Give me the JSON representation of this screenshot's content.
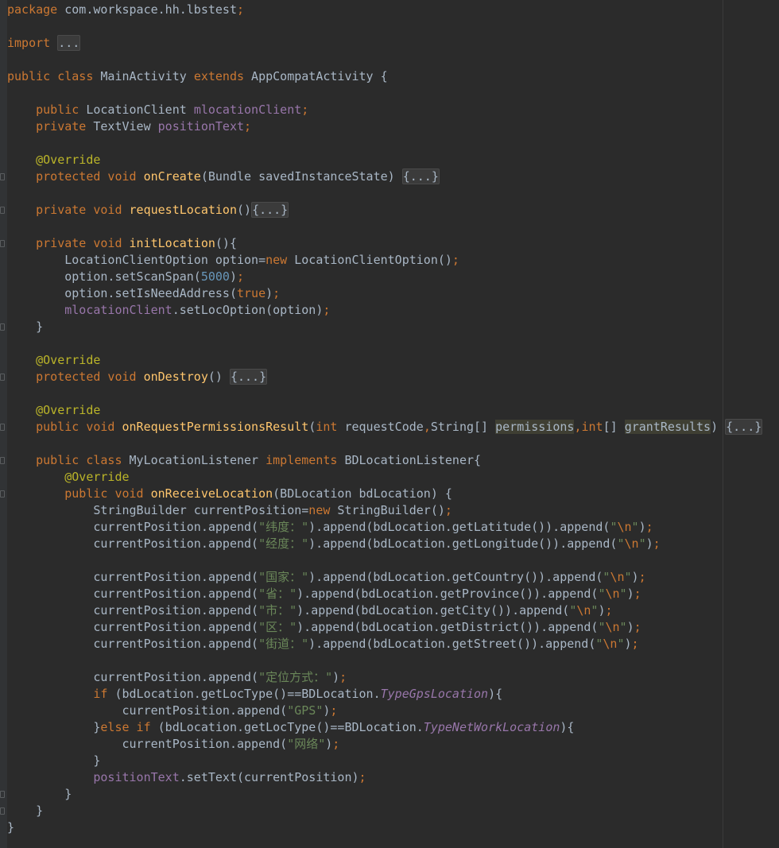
{
  "editor": {
    "language": "Java",
    "theme_colors": {
      "background": "#2b2b2b",
      "keyword": "#cc7832",
      "annotation": "#bbb529",
      "function": "#ffc66d",
      "field": "#9876aa",
      "number": "#6897bb",
      "string": "#6a8759",
      "plain": "#a9b7c6"
    },
    "lines": [
      {
        "fold": false,
        "tokens": [
          {
            "t": "package",
            "c": "kw"
          },
          {
            "t": " com.workspace.hh.lbstest",
            "c": "plain"
          },
          {
            "t": ";",
            "c": "kw"
          }
        ]
      },
      {
        "fold": false,
        "tokens": []
      },
      {
        "fold": false,
        "tokens": [
          {
            "t": "import",
            "c": "kw"
          },
          {
            "t": " ",
            "c": "plain"
          },
          {
            "t": "...",
            "c": "folded"
          }
        ]
      },
      {
        "fold": false,
        "tokens": []
      },
      {
        "fold": false,
        "tokens": [
          {
            "t": "public class",
            "c": "kw"
          },
          {
            "t": " MainActivity ",
            "c": "plain"
          },
          {
            "t": "extends",
            "c": "kw"
          },
          {
            "t": " AppCompatActivity {",
            "c": "plain"
          }
        ]
      },
      {
        "fold": false,
        "tokens": []
      },
      {
        "fold": false,
        "tokens": [
          {
            "t": "    ",
            "c": "plain"
          },
          {
            "t": "public",
            "c": "kw"
          },
          {
            "t": " LocationClient ",
            "c": "plain"
          },
          {
            "t": "mlocationClient",
            "c": "field"
          },
          {
            "t": ";",
            "c": "kw"
          }
        ]
      },
      {
        "fold": false,
        "tokens": [
          {
            "t": "    ",
            "c": "plain"
          },
          {
            "t": "private",
            "c": "kw"
          },
          {
            "t": " TextView ",
            "c": "plain"
          },
          {
            "t": "positionText",
            "c": "field"
          },
          {
            "t": ";",
            "c": "kw"
          }
        ]
      },
      {
        "fold": false,
        "tokens": []
      },
      {
        "fold": false,
        "tokens": [
          {
            "t": "    ",
            "c": "plain"
          },
          {
            "t": "@Override",
            "c": "ann"
          }
        ]
      },
      {
        "fold": true,
        "tokens": [
          {
            "t": "    ",
            "c": "plain"
          },
          {
            "t": "protected void",
            "c": "kw"
          },
          {
            "t": " ",
            "c": "plain"
          },
          {
            "t": "onCreate",
            "c": "fn"
          },
          {
            "t": "(Bundle savedInstanceState) ",
            "c": "plain"
          },
          {
            "t": "{...}",
            "c": "folded"
          }
        ]
      },
      {
        "fold": false,
        "tokens": []
      },
      {
        "fold": true,
        "tokens": [
          {
            "t": "    ",
            "c": "plain"
          },
          {
            "t": "private void",
            "c": "kw"
          },
          {
            "t": " ",
            "c": "plain"
          },
          {
            "t": "requestLocation",
            "c": "fn"
          },
          {
            "t": "()",
            "c": "plain"
          },
          {
            "t": "{...}",
            "c": "folded"
          }
        ]
      },
      {
        "fold": false,
        "tokens": []
      },
      {
        "fold": true,
        "tokens": [
          {
            "t": "    ",
            "c": "plain"
          },
          {
            "t": "private void",
            "c": "kw"
          },
          {
            "t": " ",
            "c": "plain"
          },
          {
            "t": "initLocation",
            "c": "fn"
          },
          {
            "t": "(){",
            "c": "plain"
          }
        ]
      },
      {
        "fold": false,
        "tokens": [
          {
            "t": "        LocationClientOption option=",
            "c": "plain"
          },
          {
            "t": "new",
            "c": "kw"
          },
          {
            "t": " LocationClientOption()",
            "c": "plain"
          },
          {
            "t": ";",
            "c": "kw"
          }
        ]
      },
      {
        "fold": false,
        "tokens": [
          {
            "t": "        option.setScanSpan(",
            "c": "plain"
          },
          {
            "t": "5000",
            "c": "num"
          },
          {
            "t": ")",
            "c": "plain"
          },
          {
            "t": ";",
            "c": "kw"
          }
        ]
      },
      {
        "fold": false,
        "tokens": [
          {
            "t": "        option.setIsNeedAddress(",
            "c": "plain"
          },
          {
            "t": "true",
            "c": "kw"
          },
          {
            "t": ")",
            "c": "plain"
          },
          {
            "t": ";",
            "c": "kw"
          }
        ]
      },
      {
        "fold": false,
        "tokens": [
          {
            "t": "        ",
            "c": "plain"
          },
          {
            "t": "mlocationClient",
            "c": "field"
          },
          {
            "t": ".setLocOption(option)",
            "c": "plain"
          },
          {
            "t": ";",
            "c": "kw"
          }
        ]
      },
      {
        "fold": true,
        "tokens": [
          {
            "t": "    }",
            "c": "plain"
          }
        ]
      },
      {
        "fold": false,
        "tokens": []
      },
      {
        "fold": false,
        "tokens": [
          {
            "t": "    ",
            "c": "plain"
          },
          {
            "t": "@Override",
            "c": "ann"
          }
        ]
      },
      {
        "fold": true,
        "tokens": [
          {
            "t": "    ",
            "c": "plain"
          },
          {
            "t": "protected void",
            "c": "kw"
          },
          {
            "t": " ",
            "c": "plain"
          },
          {
            "t": "onDestroy",
            "c": "fn"
          },
          {
            "t": "() ",
            "c": "plain"
          },
          {
            "t": "{...}",
            "c": "folded"
          }
        ]
      },
      {
        "fold": false,
        "tokens": []
      },
      {
        "fold": false,
        "tokens": [
          {
            "t": "    ",
            "c": "plain"
          },
          {
            "t": "@Override",
            "c": "ann"
          }
        ]
      },
      {
        "fold": true,
        "tokens": [
          {
            "t": "    ",
            "c": "plain"
          },
          {
            "t": "public void",
            "c": "kw"
          },
          {
            "t": " ",
            "c": "plain"
          },
          {
            "t": "onRequestPermissionsResult",
            "c": "fn"
          },
          {
            "t": "(",
            "c": "plain"
          },
          {
            "t": "int",
            "c": "kw"
          },
          {
            "t": " requestCode",
            "c": "plain"
          },
          {
            "t": ",",
            "c": "kw"
          },
          {
            "t": "String[] ",
            "c": "plain"
          },
          {
            "t": "permissions",
            "c": "unused"
          },
          {
            "t": ",",
            "c": "kw"
          },
          {
            "t": "int",
            "c": "kw"
          },
          {
            "t": "[] ",
            "c": "plain"
          },
          {
            "t": "grantResults",
            "c": "unused"
          },
          {
            "t": ") ",
            "c": "plain"
          },
          {
            "t": "{...}",
            "c": "folded"
          }
        ]
      },
      {
        "fold": false,
        "tokens": []
      },
      {
        "fold": true,
        "tokens": [
          {
            "t": "    ",
            "c": "plain"
          },
          {
            "t": "public class",
            "c": "kw"
          },
          {
            "t": " MyLocationListener ",
            "c": "plain"
          },
          {
            "t": "implements",
            "c": "kw"
          },
          {
            "t": " BDLocationListener{",
            "c": "plain"
          }
        ]
      },
      {
        "fold": false,
        "tokens": [
          {
            "t": "        ",
            "c": "plain"
          },
          {
            "t": "@Override",
            "c": "ann"
          }
        ]
      },
      {
        "fold": true,
        "tokens": [
          {
            "t": "        ",
            "c": "plain"
          },
          {
            "t": "public void",
            "c": "kw"
          },
          {
            "t": " ",
            "c": "plain"
          },
          {
            "t": "onReceiveLocation",
            "c": "fn"
          },
          {
            "t": "(BDLocation bdLocation) {",
            "c": "plain"
          }
        ]
      },
      {
        "fold": false,
        "tokens": [
          {
            "t": "            StringBuilder currentPosition=",
            "c": "plain"
          },
          {
            "t": "new",
            "c": "kw"
          },
          {
            "t": " StringBuilder()",
            "c": "plain"
          },
          {
            "t": ";",
            "c": "kw"
          }
        ]
      },
      {
        "fold": false,
        "tokens": [
          {
            "t": "            currentPosition.append(",
            "c": "plain"
          },
          {
            "t": "\"纬度：\"",
            "c": "str"
          },
          {
            "t": ").append(bdLocation.getLatitude()).append(",
            "c": "plain"
          },
          {
            "t": "\"",
            "c": "str"
          },
          {
            "t": "\\n",
            "c": "esc"
          },
          {
            "t": "\"",
            "c": "str"
          },
          {
            "t": ")",
            "c": "plain"
          },
          {
            "t": ";",
            "c": "kw"
          }
        ]
      },
      {
        "fold": false,
        "tokens": [
          {
            "t": "            currentPosition.append(",
            "c": "plain"
          },
          {
            "t": "\"经度：\"",
            "c": "str"
          },
          {
            "t": ").append(bdLocation.getLongitude()).append(",
            "c": "plain"
          },
          {
            "t": "\"",
            "c": "str"
          },
          {
            "t": "\\n",
            "c": "esc"
          },
          {
            "t": "\"",
            "c": "str"
          },
          {
            "t": ")",
            "c": "plain"
          },
          {
            "t": ";",
            "c": "kw"
          }
        ]
      },
      {
        "fold": false,
        "tokens": []
      },
      {
        "fold": false,
        "tokens": [
          {
            "t": "            currentPosition.append(",
            "c": "plain"
          },
          {
            "t": "\"国家：\"",
            "c": "str"
          },
          {
            "t": ").append(bdLocation.getCountry()).append(",
            "c": "plain"
          },
          {
            "t": "\"",
            "c": "str"
          },
          {
            "t": "\\n",
            "c": "esc"
          },
          {
            "t": "\"",
            "c": "str"
          },
          {
            "t": ")",
            "c": "plain"
          },
          {
            "t": ";",
            "c": "kw"
          }
        ]
      },
      {
        "fold": false,
        "tokens": [
          {
            "t": "            currentPosition.append(",
            "c": "plain"
          },
          {
            "t": "\"省：\"",
            "c": "str"
          },
          {
            "t": ").append(bdLocation.getProvince()).append(",
            "c": "plain"
          },
          {
            "t": "\"",
            "c": "str"
          },
          {
            "t": "\\n",
            "c": "esc"
          },
          {
            "t": "\"",
            "c": "str"
          },
          {
            "t": ")",
            "c": "plain"
          },
          {
            "t": ";",
            "c": "kw"
          }
        ]
      },
      {
        "fold": false,
        "tokens": [
          {
            "t": "            currentPosition.append(",
            "c": "plain"
          },
          {
            "t": "\"市：\"",
            "c": "str"
          },
          {
            "t": ").append(bdLocation.getCity()).append(",
            "c": "plain"
          },
          {
            "t": "\"",
            "c": "str"
          },
          {
            "t": "\\n",
            "c": "esc"
          },
          {
            "t": "\"",
            "c": "str"
          },
          {
            "t": ")",
            "c": "plain"
          },
          {
            "t": ";",
            "c": "kw"
          }
        ]
      },
      {
        "fold": false,
        "tokens": [
          {
            "t": "            currentPosition.append(",
            "c": "plain"
          },
          {
            "t": "\"区：\"",
            "c": "str"
          },
          {
            "t": ").append(bdLocation.getDistrict()).append(",
            "c": "plain"
          },
          {
            "t": "\"",
            "c": "str"
          },
          {
            "t": "\\n",
            "c": "esc"
          },
          {
            "t": "\"",
            "c": "str"
          },
          {
            "t": ")",
            "c": "plain"
          },
          {
            "t": ";",
            "c": "kw"
          }
        ]
      },
      {
        "fold": false,
        "tokens": [
          {
            "t": "            currentPosition.append(",
            "c": "plain"
          },
          {
            "t": "\"街道：\"",
            "c": "str"
          },
          {
            "t": ").append(bdLocation.getStreet()).append(",
            "c": "plain"
          },
          {
            "t": "\"",
            "c": "str"
          },
          {
            "t": "\\n",
            "c": "esc"
          },
          {
            "t": "\"",
            "c": "str"
          },
          {
            "t": ")",
            "c": "plain"
          },
          {
            "t": ";",
            "c": "kw"
          }
        ]
      },
      {
        "fold": false,
        "tokens": []
      },
      {
        "fold": false,
        "tokens": [
          {
            "t": "            currentPosition.append(",
            "c": "plain"
          },
          {
            "t": "\"定位方式：\"",
            "c": "str"
          },
          {
            "t": ")",
            "c": "plain"
          },
          {
            "t": ";",
            "c": "kw"
          }
        ]
      },
      {
        "fold": false,
        "tokens": [
          {
            "t": "            ",
            "c": "plain"
          },
          {
            "t": "if",
            "c": "kw"
          },
          {
            "t": " (bdLocation.getLocType()==BDLocation.",
            "c": "plain"
          },
          {
            "t": "TypeGpsLocation",
            "c": "cst"
          },
          {
            "t": "){",
            "c": "plain"
          }
        ]
      },
      {
        "fold": false,
        "tokens": [
          {
            "t": "                currentPosition.append(",
            "c": "plain"
          },
          {
            "t": "\"GPS\"",
            "c": "str"
          },
          {
            "t": ")",
            "c": "plain"
          },
          {
            "t": ";",
            "c": "kw"
          }
        ]
      },
      {
        "fold": false,
        "tokens": [
          {
            "t": "            }",
            "c": "plain"
          },
          {
            "t": "else if",
            "c": "kw"
          },
          {
            "t": " (bdLocation.getLocType()==BDLocation.",
            "c": "plain"
          },
          {
            "t": "TypeNetWorkLocation",
            "c": "cst"
          },
          {
            "t": "){",
            "c": "plain"
          }
        ]
      },
      {
        "fold": false,
        "tokens": [
          {
            "t": "                currentPosition.append(",
            "c": "plain"
          },
          {
            "t": "\"网络\"",
            "c": "str"
          },
          {
            "t": ")",
            "c": "plain"
          },
          {
            "t": ";",
            "c": "kw"
          }
        ]
      },
      {
        "fold": false,
        "tokens": [
          {
            "t": "            }",
            "c": "plain"
          }
        ]
      },
      {
        "fold": false,
        "tokens": [
          {
            "t": "            ",
            "c": "plain"
          },
          {
            "t": "positionText",
            "c": "field"
          },
          {
            "t": ".setText(currentPosition)",
            "c": "plain"
          },
          {
            "t": ";",
            "c": "kw"
          }
        ]
      },
      {
        "fold": true,
        "tokens": [
          {
            "t": "        }",
            "c": "plain"
          }
        ]
      },
      {
        "fold": true,
        "tokens": [
          {
            "t": "    }",
            "c": "plain"
          }
        ]
      },
      {
        "fold": false,
        "tokens": [
          {
            "t": "}",
            "c": "plain"
          }
        ]
      }
    ]
  }
}
